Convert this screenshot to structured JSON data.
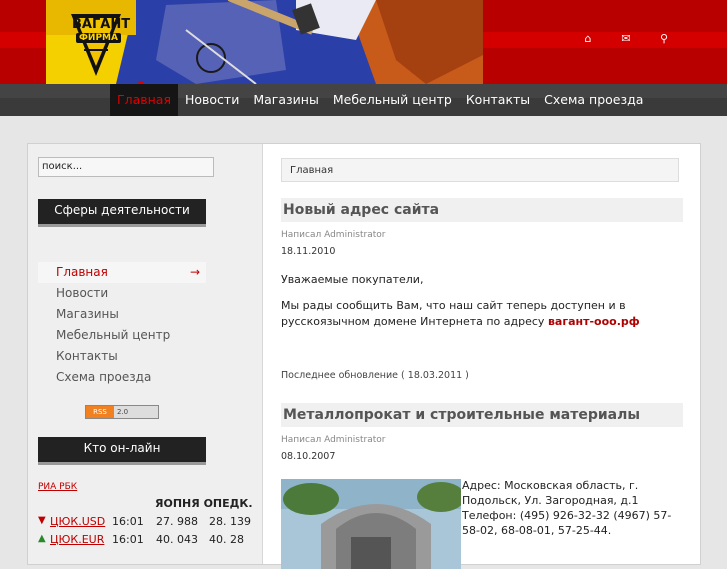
{
  "header": {
    "logo_text": "ВАГАНТ",
    "logo_subtext": "ФИРМА",
    "icons": [
      {
        "name": "home-icon",
        "glyph": "⌂"
      },
      {
        "name": "mail-icon",
        "glyph": "✉"
      },
      {
        "name": "search-icon",
        "glyph": "⚲"
      }
    ]
  },
  "nav": {
    "items": [
      {
        "label": "Главная",
        "active": true
      },
      {
        "label": "Новости"
      },
      {
        "label": "Магазины"
      },
      {
        "label": "Мебельный центр"
      },
      {
        "label": "Контакты"
      },
      {
        "label": "Схема проезда"
      }
    ]
  },
  "sidebar": {
    "search_placeholder": "поиск...",
    "spheres_title": "Сферы деятельности",
    "menu": [
      {
        "label": "Главная",
        "active": true,
        "arrow": "→"
      },
      {
        "label": "Новости"
      },
      {
        "label": "Магазины"
      },
      {
        "label": "Мебельный центр"
      },
      {
        "label": "Контакты"
      },
      {
        "label": "Схема проезда"
      }
    ],
    "rss_left": "RSS",
    "rss_right": "2.0",
    "online_title": "Кто он-лайн",
    "ria_link": "РИА РБК",
    "rates": {
      "col1": "ЯОПНЯ",
      "col2": "ОПЕДК.",
      "rows": [
        {
          "dir": "▼",
          "dir_color": "#c00000",
          "name": "ЦЮК.USD",
          "time": "16:01",
          "v1": "27. 988",
          "v2": "28. 139"
        },
        {
          "dir": "▲",
          "dir_color": "#2a8a2a",
          "name": "ЦЮК.EUR",
          "time": "16:01",
          "v1": "40. 043",
          "v2": "40. 28"
        }
      ]
    }
  },
  "content": {
    "breadcrumb": "Главная",
    "articles": [
      {
        "title": "Новый адрес сайта",
        "author": "Написал Administrator",
        "date": "18.11.2010",
        "greeting": "Уважаемые покупатели,",
        "body": "Мы рады сообщить Вам, что наш сайт теперь доступен и в русскоязычном домене Интернета по адресу ",
        "link": "вагант-ооо.рф",
        "updated": "Последнее обновление ( 18.03.2011 )"
      },
      {
        "title": "Металлопрокат и строительные материалы",
        "author": "Написал Administrator",
        "date": "08.10.2007",
        "address": "Адрес: Московская область, г. Подольск, Ул. Загородная, д.1 Телефон: (495) 926-32-32  (4967) 57-58-02, 68-08-01, 57-25-44."
      }
    ]
  }
}
